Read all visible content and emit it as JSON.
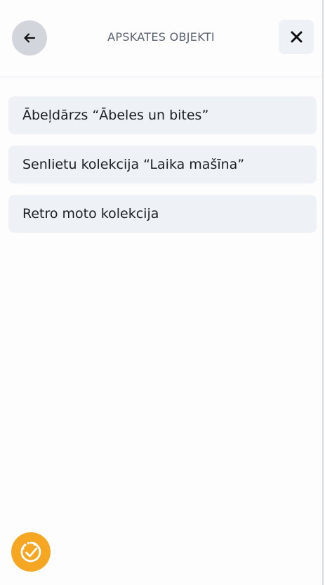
{
  "header": {
    "title": "APSKATES OBJEKTI",
    "back_icon": "arrow-left-icon",
    "close_icon": "close-icon"
  },
  "list": {
    "items": [
      {
        "label": "Ābeļdārzs “Ābeles un bites”"
      },
      {
        "label": "Senlietu kolekcija “Laika mašīna”"
      },
      {
        "label": "Retro moto kolekcija"
      }
    ]
  },
  "fab": {
    "icon": "clock-check-icon"
  },
  "colors": {
    "accent": "#f5a623",
    "item_background": "#eef2f6",
    "back_button": "#d2d5db"
  }
}
